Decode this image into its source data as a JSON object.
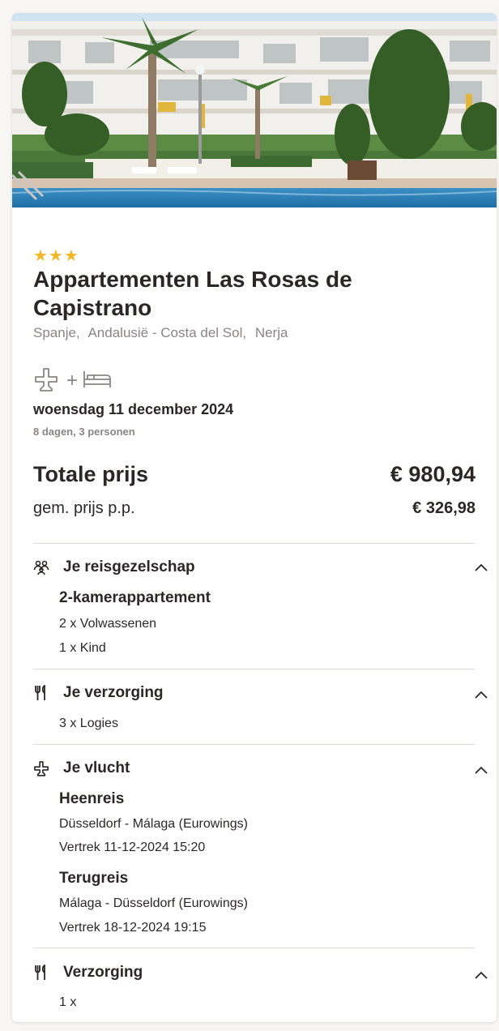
{
  "hotel": {
    "stars_display": "★★★",
    "stars": 3,
    "name": "Appartementen Las Rosas de Capistrano",
    "location": [
      "Spanje,",
      "Andalusië - Costa del Sol,",
      "Nerja"
    ]
  },
  "trip": {
    "icons": [
      "airplane-icon",
      "bed-icon"
    ],
    "plus": "+",
    "date": "woensdag 11 december 2024",
    "duration": "8 dagen, 3 personen"
  },
  "price": {
    "total_label": "Totale prijs",
    "total_value": "€ 980,94",
    "pp_label": "gem. prijs p.p.",
    "pp_value": "€ 326,98"
  },
  "sections": {
    "party": {
      "title": "Je reisgezelschap",
      "icon": "people-icon",
      "room": "2-kamerappartement",
      "adults": "2 x Volwassenen",
      "child": "1 x Kind"
    },
    "board": {
      "title": "Je verzorging",
      "icon": "cutlery-icon",
      "value": "3 x Logies"
    },
    "flight": {
      "title": "Je vlucht",
      "icon": "airplane-icon",
      "outbound_title": "Heenreis",
      "outbound_route": "Düsseldorf - Málaga (Eurowings)",
      "outbound_time": "Vertrek 11-12-2024 15:20",
      "return_title": "Terugreis",
      "return_route": "Málaga - Düsseldorf (Eurowings)",
      "return_time": "Vertrek 18-12-2024 19:15"
    },
    "catering": {
      "title": "Verzorging",
      "icon": "cutlery-icon",
      "value": "1 x"
    }
  },
  "colors": {
    "star": "#f2b829",
    "text": "#2b2727",
    "muted": "#8a8584",
    "divider": "#dcd9d6"
  }
}
